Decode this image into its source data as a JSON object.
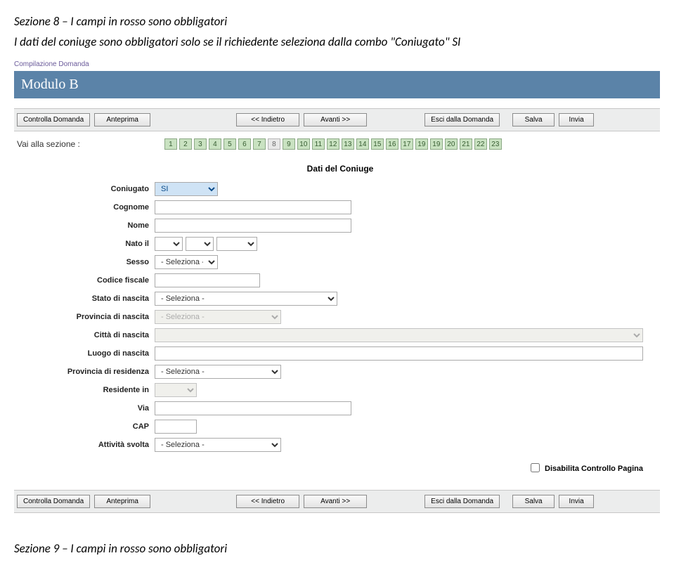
{
  "title1": "Sezione 8 – I campi in rosso sono obbligatori",
  "sub1": "I dati del coniuge sono obbligatori solo se il richiedente seleziona dalla combo \"Coniugato\" SI",
  "compila": "Compilazione Domanda",
  "modulo": "Modulo B",
  "toolbar": {
    "controlla": "Controlla Domanda",
    "anteprima": "Anteprima",
    "indietro": "<< Indietro",
    "avanti": "Avanti >>",
    "esci": "Esci dalla Domanda",
    "salva": "Salva",
    "invia": "Invia"
  },
  "sezioni_label": "Vai alla sezione :",
  "pages": [
    "1",
    "2",
    "3",
    "4",
    "5",
    "6",
    "7",
    "8",
    "9",
    "10",
    "11",
    "12",
    "13",
    "14",
    "15",
    "16",
    "17",
    "19",
    "19",
    "20",
    "21",
    "22",
    "23"
  ],
  "current_page": "8",
  "form": {
    "title": "Dati del Coniuge",
    "coniugato": {
      "label": "Coniugato",
      "value": "SI"
    },
    "cognome": {
      "label": "Cognome",
      "value": ""
    },
    "nome": {
      "label": "Nome",
      "value": ""
    },
    "nato": {
      "label": "Nato il"
    },
    "sesso": {
      "label": "Sesso",
      "value": "- Seleziona -"
    },
    "cf": {
      "label": "Codice fiscale",
      "value": ""
    },
    "stato": {
      "label": "Stato di nascita",
      "value": "- Seleziona -"
    },
    "prov_nascita": {
      "label": "Provincia di nascita",
      "value": "- Seleziona -"
    },
    "citta_nascita": {
      "label": "Città di nascita",
      "value": ""
    },
    "luogo_nascita": {
      "label": "Luogo di nascita",
      "value": ""
    },
    "prov_res": {
      "label": "Provincia di residenza",
      "value": "- Seleziona -"
    },
    "residente": {
      "label": "Residente in",
      "value": ""
    },
    "via": {
      "label": "Via",
      "value": ""
    },
    "cap": {
      "label": "CAP",
      "value": ""
    },
    "attivita": {
      "label": "Attività svolta",
      "value": "- Seleziona -"
    }
  },
  "chk_label": "Disabilita Controllo Pagina",
  "title2": "Sezione 9 – I campi in rosso sono obbligatori"
}
